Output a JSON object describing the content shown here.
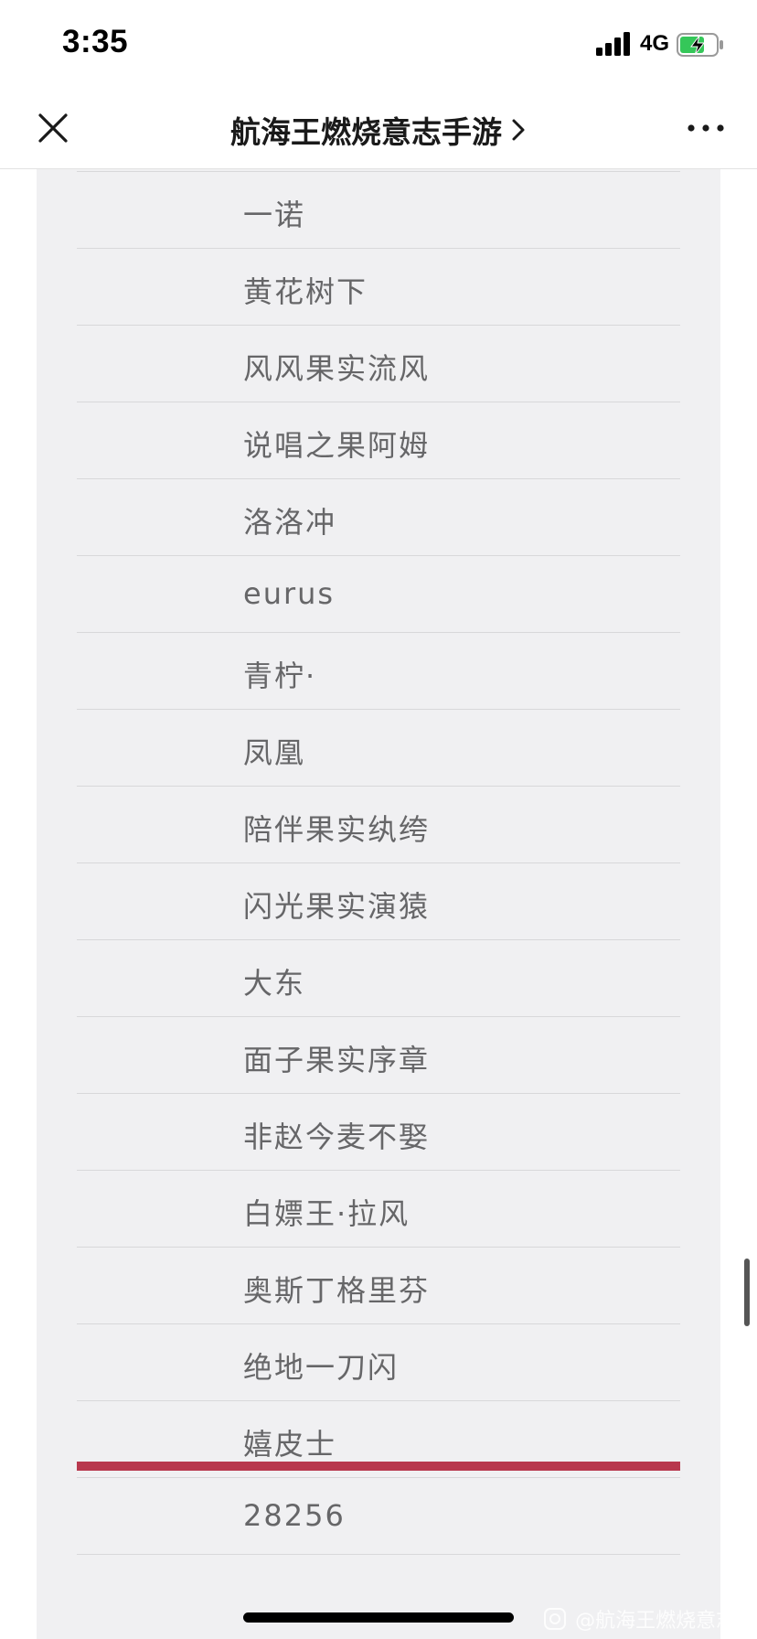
{
  "status_bar": {
    "time": "3:35",
    "network": "4G",
    "icons": [
      "signal-icon",
      "battery-charging-icon"
    ]
  },
  "nav": {
    "title": "航海王燃烧意志手游",
    "icons": [
      "close-icon",
      "chevron-right-icon",
      "more-icon"
    ]
  },
  "entries": [
    "一诺",
    "黄花树下",
    "风风果实流风",
    "说唱之果阿姆",
    "洛洛冲",
    "eurus",
    "青柠·",
    "凤凰",
    "陪伴果实纨绔",
    "闪光果实演猿",
    "大东",
    "面子果实序章",
    "非赵今麦不娶",
    "白嫖王·拉风",
    "奥斯丁格里芬",
    "绝地一刀闪",
    "嬉皮士",
    "28256"
  ],
  "watermark": {
    "text": "@航海王燃烧意志",
    "icon": "weibo-camera-icon"
  },
  "colors": {
    "card_background": "#f0f0f2",
    "entry_text": "#666668",
    "divider": "#d8d8da",
    "accent_bar": "#b8384e"
  }
}
